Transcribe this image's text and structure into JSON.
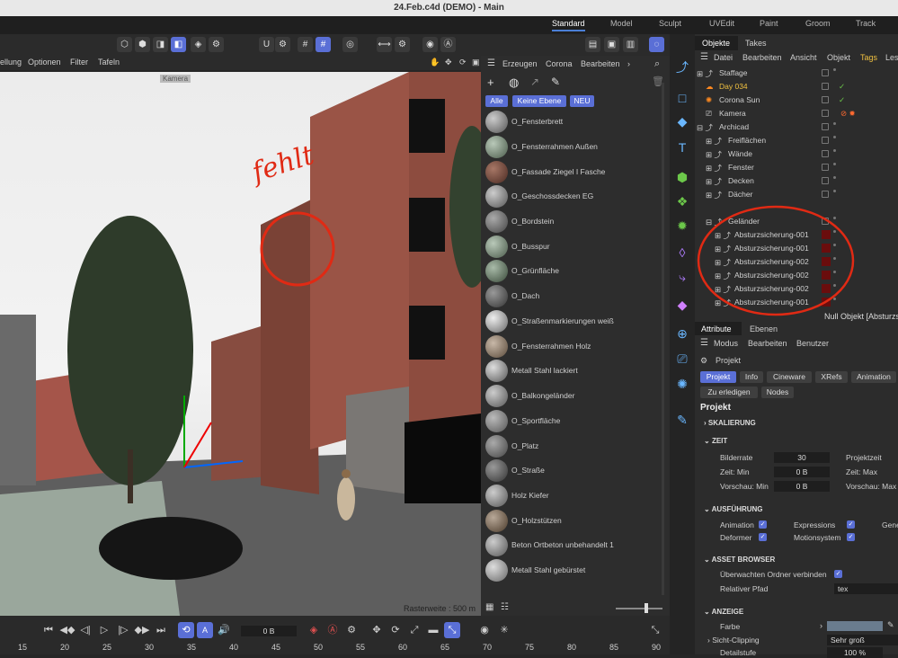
{
  "window": {
    "title": "24.Feb.c4d (DEMO) - Main"
  },
  "layout_tabs": [
    "Standard",
    "Model",
    "Sculpt",
    "UVEdit",
    "Paint",
    "Groom",
    "Track"
  ],
  "viewport": {
    "menu": [
      "ellung",
      "Optionen",
      "Filter",
      "Tafeln"
    ],
    "camera_label": "Kamera",
    "status": "Rasterweite : 500 m",
    "annotation": "fehlt"
  },
  "materials": {
    "menu": [
      "Erzeugen",
      "Corona",
      "Bearbeiten"
    ],
    "filters": [
      "Alle",
      "Keine Ebene",
      "NEU"
    ],
    "items": [
      "O_Fensterbrett",
      "O_Fensterrahmen Außen",
      "O_Fassade Ziegel I Fasche",
      "O_Geschossdecken EG",
      "O_Bordstein",
      "O_Busspur",
      "O_Grünfläche",
      "O_Dach",
      "O_Straßenmarkierungen weiß",
      "O_Fensterrahmen Holz",
      "Metall Stahl lackiert",
      "O_Balkongeländer",
      "O_Sportfläche",
      "O_Platz",
      "O_Straße",
      "Holz Kiefer",
      "O_Holzstützen",
      "Beton Ortbeton unbehandelt 1",
      "Metall Stahl gebürstet"
    ]
  },
  "objects": {
    "tabs": [
      "Objekte",
      "Takes"
    ],
    "menu": [
      "Datei",
      "Bearbeiten",
      "Ansicht",
      "Objekt",
      "Tags",
      "Les"
    ],
    "items": [
      "Staffage",
      "Day 034",
      "Corona Sun",
      "Kamera",
      "Archicad",
      "Freiflächen",
      "Wände",
      "Fenster",
      "Decken",
      "Dächer",
      "Geländer",
      "Absturzsicherung-001",
      "Absturzsicherung-001",
      "Absturzsicherung-002",
      "Absturzsicherung-002",
      "Absturzsicherung-002",
      "Absturzsicherung-001"
    ],
    "status": "Null Objekt [Absturzs"
  },
  "attributes": {
    "tabs": [
      "Attribute",
      "Ebenen"
    ],
    "menu": [
      "Modus",
      "Bearbeiten",
      "Benutzer"
    ],
    "object": "Projekt",
    "subtabs": [
      "Projekt",
      "Info",
      "Cineware",
      "XRefs",
      "Animation",
      "Zu erledigen",
      "Nodes"
    ],
    "heading": "Projekt",
    "sections": [
      "SKALIERUNG",
      "ZEIT",
      "AUSFÜHRUNG",
      "ASSET BROWSER",
      "ANZEIGE"
    ],
    "zeit": {
      "bilderrate_label": "Bilderrate",
      "bilderrate": "30",
      "projektzeit_label": "Projektzeit",
      "zeit_min_label": "Zeit: Min",
      "zeit_min": "0 B",
      "zeit_max_label": "Zeit: Max",
      "vorschau_min_label": "Vorschau: Min",
      "vorschau_min": "0 B",
      "vorschau_max_label": "Vorschau: Max"
    },
    "ausfuehrung": [
      "Animation",
      "Expressions",
      "Gene",
      "Deformer",
      "Motionsystem"
    ],
    "asset": {
      "watch_label": "Überwachten Ordner verbinden",
      "path_label": "Relativer Pfad",
      "path": "tex"
    },
    "anzeige": {
      "farbe": "Farbe",
      "sicht_label": "Sicht-Clipping",
      "sicht": "Sehr groß",
      "detail_label": "Detailstufe",
      "detail": "100 %"
    }
  },
  "timeline": {
    "frame": "0 B",
    "ticks": [
      "15",
      "20",
      "25",
      "30",
      "35",
      "40",
      "45",
      "50",
      "55",
      "60",
      "65",
      "70",
      "75",
      "80",
      "85",
      "90"
    ]
  }
}
